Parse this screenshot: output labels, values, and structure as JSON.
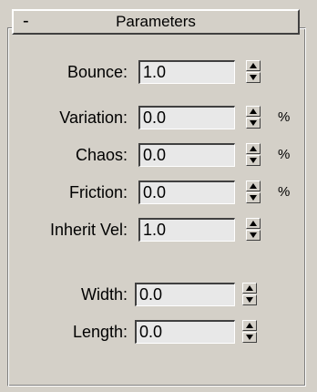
{
  "rollout": {
    "toggle": "-",
    "title": "Parameters"
  },
  "params": [
    {
      "id": "bounce",
      "label": "Bounce:",
      "value": "1.0",
      "unit": ""
    },
    {
      "id": "variation",
      "label": "Variation:",
      "value": "0.0",
      "unit": "%"
    },
    {
      "id": "chaos",
      "label": "Chaos:",
      "value": "0.0",
      "unit": "%"
    },
    {
      "id": "friction",
      "label": "Friction:",
      "value": "0.0",
      "unit": "%"
    },
    {
      "id": "inherit",
      "label": "Inherit Vel:",
      "value": "1.0",
      "unit": ""
    },
    {
      "id": "width",
      "label": "Width:",
      "value": "0.0",
      "unit": ""
    },
    {
      "id": "length",
      "label": "Length:",
      "value": "0.0",
      "unit": ""
    }
  ]
}
